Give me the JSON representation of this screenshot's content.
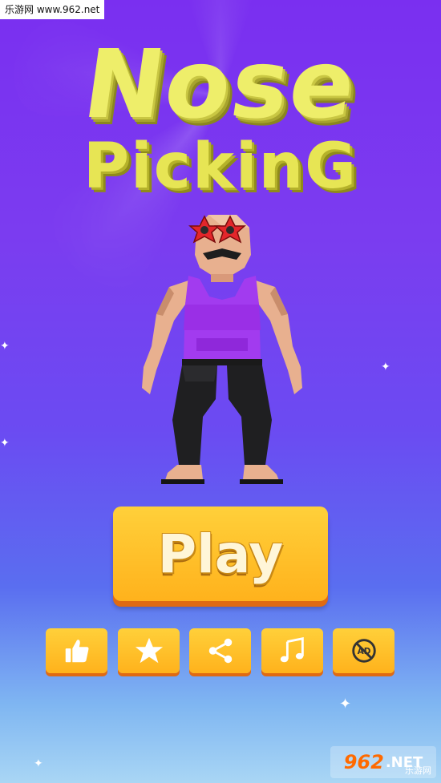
{
  "watermark_top": {
    "text": "乐游网 www.962.net"
  },
  "title": {
    "line1": "Nose",
    "line2": "PickinG"
  },
  "play_button": {
    "label": "Play"
  },
  "icon_buttons": [
    {
      "icon": "thumbs-up-icon"
    },
    {
      "icon": "star-icon"
    },
    {
      "icon": "share-icon"
    },
    {
      "icon": "music-note-icon"
    },
    {
      "icon": "no-ads-icon",
      "text": "AD"
    }
  ],
  "watermark_bottom": {
    "number": "962",
    "suffix": ".NET",
    "cn": "乐游网"
  },
  "colors": {
    "button": "#ffc12a",
    "button_shadow": "#e06a12",
    "title": "#eeee6a",
    "bg_top": "#7a2ff0",
    "bg_bottom": "#a9d6f4"
  }
}
